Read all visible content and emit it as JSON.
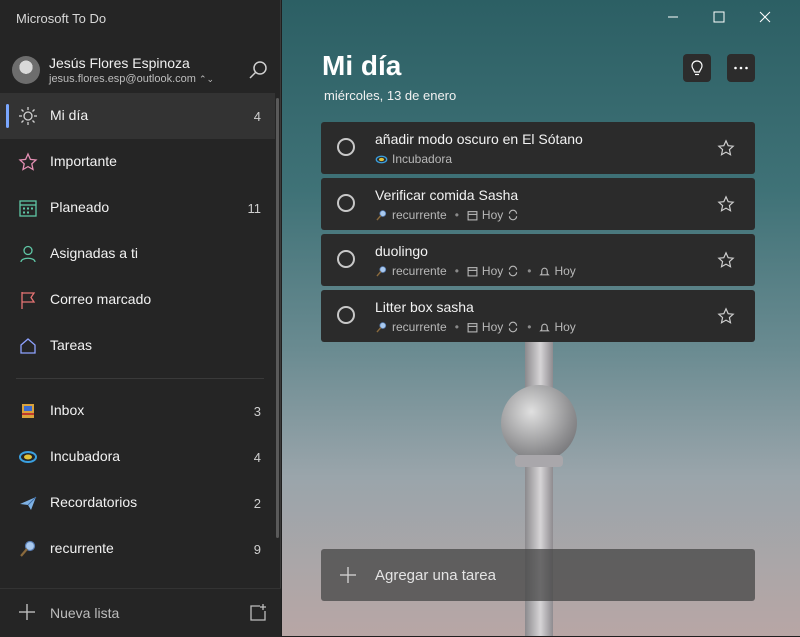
{
  "app": {
    "title": "Microsoft To Do"
  },
  "profile": {
    "name": "Jesús Flores Espinoza",
    "email": "jesus.flores.esp@outlook.com"
  },
  "sidebar": {
    "items": [
      {
        "label": "Mi día",
        "count": "4",
        "icon": "sun-icon",
        "active": true
      },
      {
        "label": "Importante",
        "count": "",
        "icon": "star-icon"
      },
      {
        "label": "Planeado",
        "count": "11",
        "icon": "calendar-icon"
      },
      {
        "label": "Asignadas a ti",
        "count": "",
        "icon": "person-icon"
      },
      {
        "label": "Correo marcado",
        "count": "",
        "icon": "flag-icon"
      },
      {
        "label": "Tareas",
        "count": "",
        "icon": "home-icon"
      }
    ],
    "lists": [
      {
        "label": "Inbox",
        "count": "3",
        "icon": "inbox-emoji-icon"
      },
      {
        "label": "Incubadora",
        "count": "4",
        "icon": "incubator-emoji-icon"
      },
      {
        "label": "Recordatorios",
        "count": "2",
        "icon": "airplane-emoji-icon"
      },
      {
        "label": "recurrente",
        "count": "9",
        "icon": "magnifier-emoji-icon"
      }
    ],
    "new_list_label": "Nueva lista"
  },
  "main": {
    "title": "Mi día",
    "date": "miércoles, 13 de enero",
    "tasks": [
      {
        "title": "añadir modo oscuro en El Sótano",
        "list": "Incubadora"
      },
      {
        "title": "Verificar comida Sasha",
        "list": "recurrente",
        "due": "Hoy"
      },
      {
        "title": "duolingo",
        "list": "recurrente",
        "due": "Hoy",
        "reminder": "Hoy"
      },
      {
        "title": "Litter box sasha",
        "list": "recurrente",
        "due": "Hoy",
        "reminder": "Hoy"
      }
    ],
    "add_task_label": "Agregar una tarea"
  },
  "colors": {
    "accent": "#7aa7ff",
    "sidebar_bg": "#252525",
    "task_bg": "#2b2b2b"
  }
}
